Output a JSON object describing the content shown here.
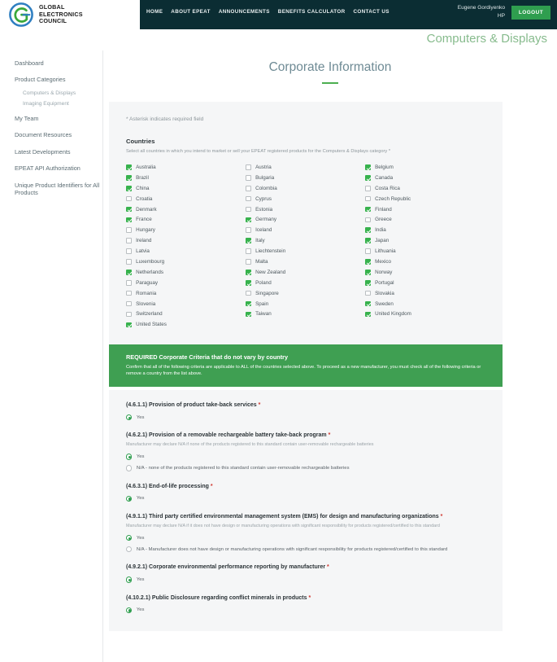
{
  "header": {
    "logo": {
      "icon": "gec-circle-g-logo",
      "line1": "GLOBAL",
      "line2": "ELECTRONICS",
      "line3": "COUNCIL"
    },
    "nav": [
      {
        "label": "HOME"
      },
      {
        "label": "ABOUT EPEAT"
      },
      {
        "label": "ANNOUNCEMENTS"
      },
      {
        "label": "BENEFITS CALCULATOR"
      },
      {
        "label": "CONTACT US"
      }
    ],
    "user": {
      "name": "Eugene Gordiyenko",
      "org": "HP"
    },
    "logout_label": "LOGOUT",
    "category_title": "Computers & Displays",
    "colors": {
      "navbar_bg": "#0b2d33",
      "logout_bg": "#2f9e4f",
      "category_title": "#87bb8d"
    }
  },
  "sidebar": {
    "items": [
      {
        "label": "Dashboard",
        "type": "item"
      },
      {
        "label": "Product Categories",
        "type": "item"
      },
      {
        "label": "Computers & Displays",
        "type": "sub"
      },
      {
        "label": "Imaging Equipment",
        "type": "sub"
      },
      {
        "label": "My Team",
        "type": "item"
      },
      {
        "label": "Document Resources",
        "type": "item"
      },
      {
        "label": "Latest Developments",
        "type": "item"
      },
      {
        "label": "EPEAT API Authorization",
        "type": "item"
      },
      {
        "label": "Unique Product Identifiers for All Products",
        "type": "item"
      }
    ]
  },
  "main": {
    "page_title": "Corporate Information",
    "asterisk_note": "* Asterisk indicates required field",
    "countries_section": {
      "title": "Countries",
      "subtitle": "Select all countries in which you intend to market or sell your EPEAT registered products for the Computers & Displays category *",
      "columns": [
        [
          {
            "label": "Australia",
            "checked": true
          },
          {
            "label": "Brazil",
            "checked": true
          },
          {
            "label": "China",
            "checked": true
          },
          {
            "label": "Croatia",
            "checked": false
          },
          {
            "label": "Denmark",
            "checked": true
          },
          {
            "label": "France",
            "checked": true
          },
          {
            "label": "Hungary",
            "checked": false
          },
          {
            "label": "Ireland",
            "checked": false
          },
          {
            "label": "Latvia",
            "checked": false
          },
          {
            "label": "Luxembourg",
            "checked": false
          },
          {
            "label": "Netherlands",
            "checked": true
          },
          {
            "label": "Paraguay",
            "checked": false
          },
          {
            "label": "Romania",
            "checked": false
          },
          {
            "label": "Slovenia",
            "checked": false
          },
          {
            "label": "Switzerland",
            "checked": false
          },
          {
            "label": "United States",
            "checked": true
          }
        ],
        [
          {
            "label": "Austria",
            "checked": false
          },
          {
            "label": "Bulgaria",
            "checked": false
          },
          {
            "label": "Colombia",
            "checked": false
          },
          {
            "label": "Cyprus",
            "checked": false
          },
          {
            "label": "Estonia",
            "checked": false
          },
          {
            "label": "Germany",
            "checked": true
          },
          {
            "label": "Iceland",
            "checked": false
          },
          {
            "label": "Italy",
            "checked": true
          },
          {
            "label": "Liechtenstein",
            "checked": false
          },
          {
            "label": "Malta",
            "checked": false
          },
          {
            "label": "New Zealand",
            "checked": true
          },
          {
            "label": "Poland",
            "checked": true
          },
          {
            "label": "Singapore",
            "checked": false
          },
          {
            "label": "Spain",
            "checked": true
          },
          {
            "label": "Taiwan",
            "checked": true
          }
        ],
        [
          {
            "label": "Belgium",
            "checked": true
          },
          {
            "label": "Canada",
            "checked": true
          },
          {
            "label": "Costa Rica",
            "checked": false
          },
          {
            "label": "Czech Republic",
            "checked": false
          },
          {
            "label": "Finland",
            "checked": true
          },
          {
            "label": "Greece",
            "checked": false
          },
          {
            "label": "India",
            "checked": true
          },
          {
            "label": "Japan",
            "checked": true
          },
          {
            "label": "Lithuania",
            "checked": false
          },
          {
            "label": "Mexico",
            "checked": true
          },
          {
            "label": "Norway",
            "checked": true
          },
          {
            "label": "Portugal",
            "checked": true
          },
          {
            "label": "Slovakia",
            "checked": false
          },
          {
            "label": "Sweden",
            "checked": true
          },
          {
            "label": "United Kingdom",
            "checked": true
          }
        ]
      ]
    },
    "required_banner": {
      "title": "REQUIRED Corporate Criteria that do not vary by country",
      "body": "Confirm that all of the following criteria are applicable to ALL of the countries selected above. To proceed as a new manufacturer, you must check all of the following criteria or remove a country from the list above.",
      "bg_color": "#3f9f52"
    },
    "criteria": [
      {
        "title": "(4.6.1.1) Provision of product take-back services",
        "required": "*",
        "help": "",
        "options": [
          {
            "label": "Yes",
            "selected": true
          }
        ]
      },
      {
        "title": "(4.6.2.1) Provision of a removable rechargeable battery take-back program",
        "required": "*",
        "help": "Manufacturer may declare N/A if none of the products registered to this standard contain user-removable rechargeable batteries",
        "options": [
          {
            "label": "Yes",
            "selected": true
          },
          {
            "label": "N/A - none of the products registered to this standard contain user-removable rechargeable batteries",
            "selected": false
          }
        ]
      },
      {
        "title": "(4.6.3.1) End-of-life processing",
        "required": "*",
        "help": "",
        "options": [
          {
            "label": "Yes",
            "selected": true
          }
        ]
      },
      {
        "title": "(4.9.1.1) Third party certified environmental management system (EMS) for design and manufacturing organizations",
        "required": "*",
        "help": "Manufacturer may declare N/A if it does not have design or manufacturing operations with significant responsibility for products registered/certified to this standard",
        "options": [
          {
            "label": "Yes",
            "selected": true
          },
          {
            "label": "N/A - Manufacturer does not have design or manufacturing operations with significant responsibility for products registered/certified to this standard",
            "selected": false
          }
        ]
      },
      {
        "title": "(4.9.2.1) Corporate environmental performance reporting by manufacturer",
        "required": "*",
        "help": "",
        "options": [
          {
            "label": "Yes",
            "selected": true
          }
        ]
      },
      {
        "title": "(4.10.2.1) Public Disclosure regarding conflict minerals in products",
        "required": "*",
        "help": "",
        "options": [
          {
            "label": "Yes",
            "selected": true
          }
        ]
      }
    ]
  }
}
